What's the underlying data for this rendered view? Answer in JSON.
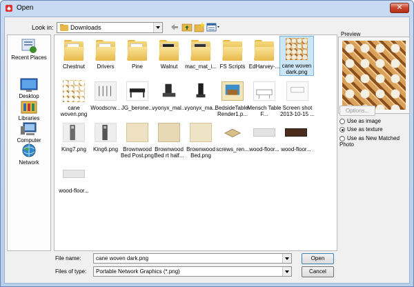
{
  "window": {
    "title": "Open",
    "close_glyph": "✕"
  },
  "lookin": {
    "label": "Look in:",
    "value": "Downloads"
  },
  "toolbar": {
    "icons": [
      "back-icon",
      "up-folder-icon",
      "new-folder-icon",
      "view-menu-icon"
    ]
  },
  "places": [
    {
      "label": "Recent Places",
      "icon": "recent-places-icon"
    },
    {
      "label": "Desktop",
      "icon": "desktop-icon"
    },
    {
      "label": "Libraries",
      "icon": "libraries-icon"
    },
    {
      "label": "Computer",
      "icon": "computer-icon"
    },
    {
      "label": "Network",
      "icon": "network-icon"
    }
  ],
  "files": [
    {
      "name": "Chestnut",
      "kind": "folder"
    },
    {
      "name": "Drivers",
      "kind": "folder"
    },
    {
      "name": "Pine",
      "kind": "folder"
    },
    {
      "name": "Walnut",
      "kind": "folder"
    },
    {
      "name": "mac_mat_i...",
      "kind": "folder"
    },
    {
      "name": "FS Scripts",
      "kind": "folder"
    },
    {
      "name": "EdHarvey-...",
      "kind": "folder"
    },
    {
      "name": "cane woven dark.png",
      "kind": "cane-dark",
      "selected": true
    },
    {
      "name": "cane woven.png",
      "kind": "cane-light"
    },
    {
      "name": "Woodscrw...",
      "kind": "image"
    },
    {
      "name": "JG_berone...",
      "kind": "image"
    },
    {
      "name": "vyonyx_mal...",
      "kind": "image"
    },
    {
      "name": "vyonyx_ma...",
      "kind": "image"
    },
    {
      "name": "BedsideTable-Render1.p...",
      "kind": "image"
    },
    {
      "name": "Mensch Table F...",
      "kind": "image"
    },
    {
      "name": "Screen shot 2013-10-15 ...",
      "kind": "image"
    },
    {
      "name": "King7.png",
      "kind": "image"
    },
    {
      "name": "King6.png",
      "kind": "image"
    },
    {
      "name": "Brownwood Bed Post.png",
      "kind": "image"
    },
    {
      "name": "Brownwood Bed rt half...",
      "kind": "image"
    },
    {
      "name": "Brownwood Bed.png",
      "kind": "image"
    },
    {
      "name": "screws_ren...",
      "kind": "image"
    },
    {
      "name": "wood-floor...",
      "kind": "image"
    },
    {
      "name": "wood-floor...",
      "kind": "image"
    },
    {
      "name": "wood-floor...",
      "kind": "image"
    }
  ],
  "preview": {
    "label": "Preview",
    "options_label": "Options..."
  },
  "import_as": [
    {
      "label": "Use as image",
      "checked": false
    },
    {
      "label": "Use as texture",
      "checked": true
    },
    {
      "label": "Use as New Matched Photo",
      "checked": false
    }
  ],
  "file_name": {
    "label": "File name:",
    "value": "cane woven dark.png"
  },
  "file_type": {
    "label": "Files of type:",
    "value": "Portable Network Graphics (*.png)"
  },
  "buttons": {
    "open": "Open",
    "cancel": "Cancel"
  },
  "colors": {
    "selection": "#cde6f7",
    "folder": "#e8b94a",
    "close_button": "#c8432c"
  }
}
